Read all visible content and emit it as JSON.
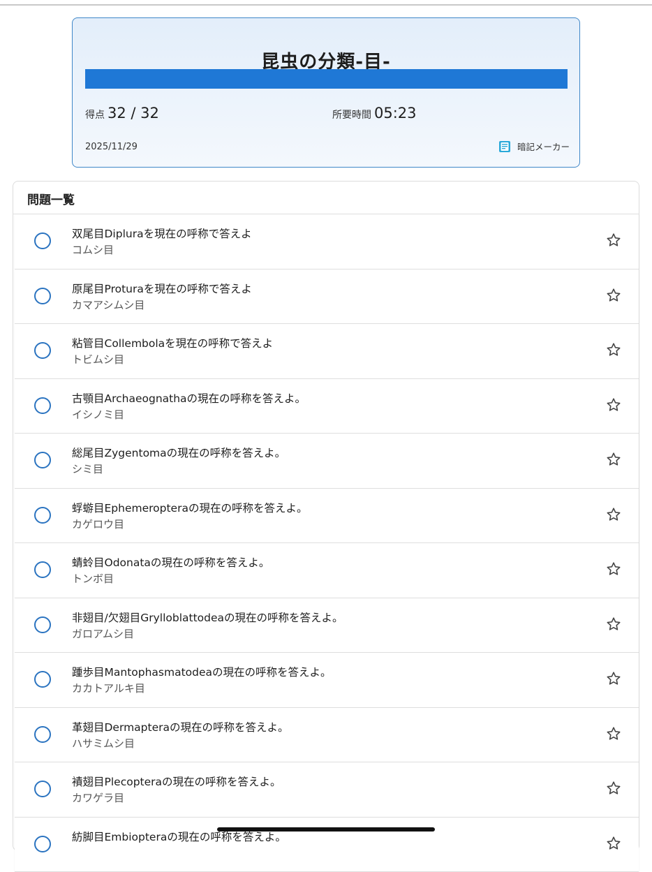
{
  "summary": {
    "title": "昆虫の分類-目-",
    "progress_fraction": 1.0,
    "score_label": "得点",
    "score_value": "32 / 32",
    "time_label": "所要時間",
    "time_value": "05:23",
    "date": "2025/11/29",
    "memo_maker_label": "暗記メーカー",
    "memo_icon": "notebook-icon"
  },
  "colors": {
    "accent": "#1f78d6",
    "status_ring": "#2a73c0"
  },
  "list": {
    "header": "問題一覧",
    "status_icon": "circle-correct-icon",
    "favorite_icon": "star-outline-icon",
    "items": [
      {
        "question": "双尾目Dipluraを現在の呼称で答えよ",
        "answer": "コムシ目"
      },
      {
        "question": "原尾目Proturaを現在の呼称で答えよ",
        "answer": "カマアシムシ目"
      },
      {
        "question": "粘管目Collembolaを現在の呼称で答えよ",
        "answer": "トビムシ目"
      },
      {
        "question": "古顎目Archaeognathaの現在の呼称を答えよ。",
        "answer": "イシノミ目"
      },
      {
        "question": "総尾目Zygentomaの現在の呼称を答えよ。",
        "answer": "シミ目"
      },
      {
        "question": "蜉蝣目Ephemeropteraの現在の呼称を答えよ。",
        "answer": "カゲロウ目"
      },
      {
        "question": "蜻蛉目Odonataの現在の呼称を答えよ。",
        "answer": "トンボ目"
      },
      {
        "question": "非翅目/欠翅目Grylloblattodeaの現在の呼称を答えよ。",
        "answer": "ガロアムシ目"
      },
      {
        "question": "踵歩目Mantophasmatodeaの現在の呼称を答えよ。",
        "answer": "カカトアルキ目"
      },
      {
        "question": "革翅目Dermapteraの現在の呼称を答えよ。",
        "answer": "ハサミムシ目"
      },
      {
        "question": "襀翅目Plecopteraの現在の呼称を答えよ。",
        "answer": "カワゲラ目"
      },
      {
        "question": "紡脚目Embiopteraの現在の呼称を答えよ。",
        "answer": ""
      }
    ]
  }
}
